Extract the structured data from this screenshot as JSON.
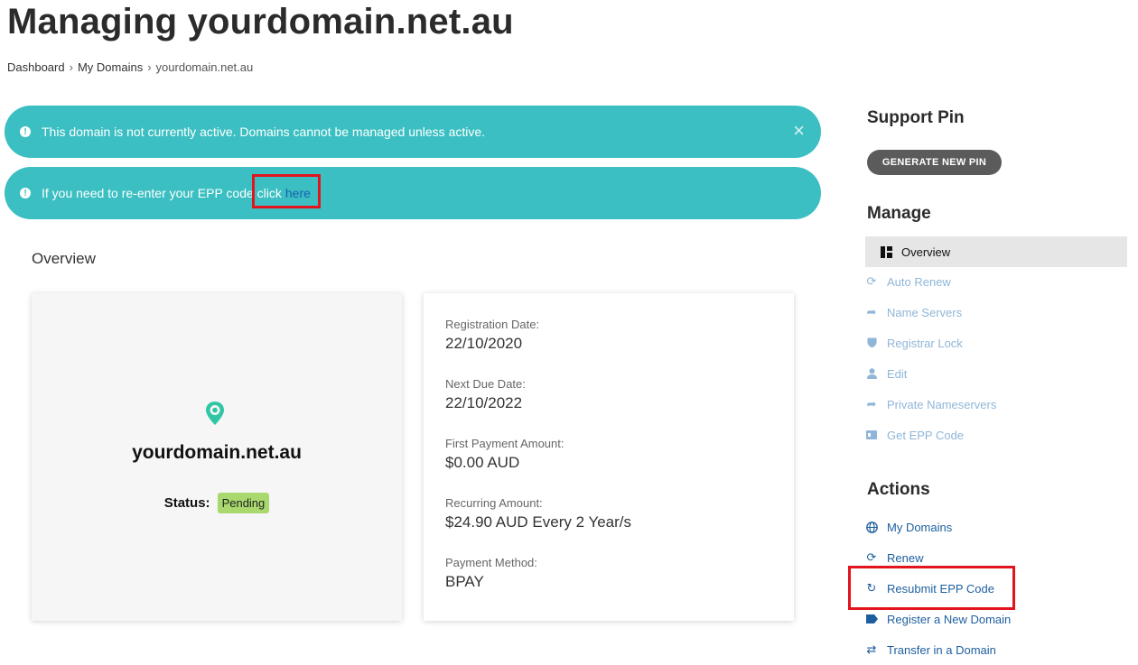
{
  "page": {
    "title": "Managing yourdomain.net.au"
  },
  "breadcrumb": {
    "items": [
      "Dashboard",
      "My Domains"
    ],
    "current": "yourdomain.net.au"
  },
  "alerts": {
    "inactive": "This domain is not currently active. Domains cannot be managed unless active.",
    "close_symbol": "×",
    "epp_text": "If you need to re-enter your EPP code click",
    "epp_link": "here"
  },
  "overview": {
    "heading": "Overview",
    "domain_name": "yourdomain.net.au",
    "status_label": "Status:",
    "status_value": "Pending",
    "status_color": "#a9d86e"
  },
  "details": [
    {
      "label": "Registration Date:",
      "value": "22/10/2020"
    },
    {
      "label": "Next Due Date:",
      "value": "22/10/2022"
    },
    {
      "label": "First Payment Amount:",
      "value": "$0.00 AUD"
    },
    {
      "label": "Recurring Amount:",
      "value": "$24.90 AUD Every 2 Year/s"
    },
    {
      "label": "Payment Method:",
      "value": "BPAY"
    }
  ],
  "support": {
    "heading": "Support Pin",
    "button": "GENERATE NEW PIN"
  },
  "manage": {
    "heading": "Manage",
    "items": [
      {
        "label": "Overview",
        "icon": "dashboard-icon"
      },
      {
        "label": "Auto Renew",
        "icon": "sync-icon"
      },
      {
        "label": "Name Servers",
        "icon": "share-arrow-icon"
      },
      {
        "label": "Registrar Lock",
        "icon": "shield-icon"
      },
      {
        "label": "Edit",
        "icon": "user-icon"
      },
      {
        "label": "Private Nameservers",
        "icon": "share-arrow-icon"
      },
      {
        "label": "Get EPP Code",
        "icon": "id-card-icon"
      }
    ]
  },
  "actions": {
    "heading": "Actions",
    "items": [
      {
        "label": "My Domains",
        "icon": "globe-icon"
      },
      {
        "label": "Renew",
        "icon": "sync-icon"
      },
      {
        "label": "Resubmit EPP Code",
        "icon": "redo-icon"
      },
      {
        "label": "Register a New Domain",
        "icon": "tag-icon"
      },
      {
        "label": "Transfer in a Domain",
        "icon": "exchange-icon"
      }
    ]
  },
  "colors": {
    "alert": "#3bbfc2",
    "highlight": "#e3141e",
    "link": "#1d5f9e"
  }
}
